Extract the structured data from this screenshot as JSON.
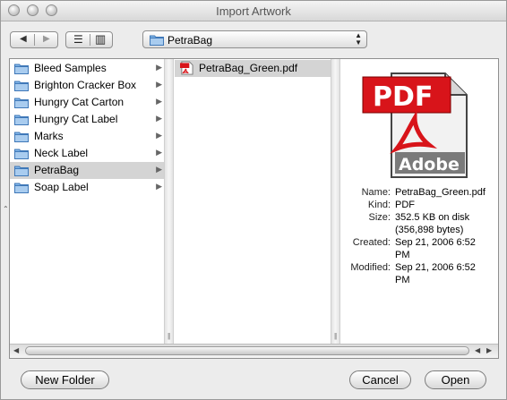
{
  "window": {
    "title": "Import Artwork"
  },
  "toolbar": {
    "back_label": "◀",
    "forward_label": "▶",
    "list_view_label": "☰",
    "column_view_label": "▥"
  },
  "location": {
    "selected": "PetraBag"
  },
  "sidebar": {
    "items": [
      {
        "label": "Bleed Samples"
      },
      {
        "label": "Brighton Cracker Box"
      },
      {
        "label": "Hungry Cat Carton"
      },
      {
        "label": "Hungry Cat Label"
      },
      {
        "label": "Marks"
      },
      {
        "label": "Neck Label"
      },
      {
        "label": "PetraBag",
        "selected": true
      },
      {
        "label": "Soap Label"
      }
    ]
  },
  "files": {
    "items": [
      {
        "label": "PetraBag_Green.pdf",
        "selected": true
      }
    ]
  },
  "preview": {
    "icon_text_top": "PDF",
    "icon_text_bottom": "Adobe",
    "name_key": "Name:",
    "name_val": "PetraBag_Green.pdf",
    "kind_key": "Kind:",
    "kind_val": "PDF",
    "size_key": "Size:",
    "size_val_1": "352.5 KB on disk",
    "size_val_2": "(356,898 bytes)",
    "created_key": "Created:",
    "created_val_1": "Sep 21, 2006 6:52",
    "created_val_2": "PM",
    "modified_key": "Modified:",
    "modified_val_1": "Sep 21, 2006 6:52",
    "modified_val_2": "PM"
  },
  "buttons": {
    "new_folder": "New Folder",
    "cancel": "Cancel",
    "open": "Open"
  },
  "colors": {
    "folder": "#7fb3e6",
    "pdf_red": "#d8141a",
    "selection": "#d4d4d4"
  }
}
